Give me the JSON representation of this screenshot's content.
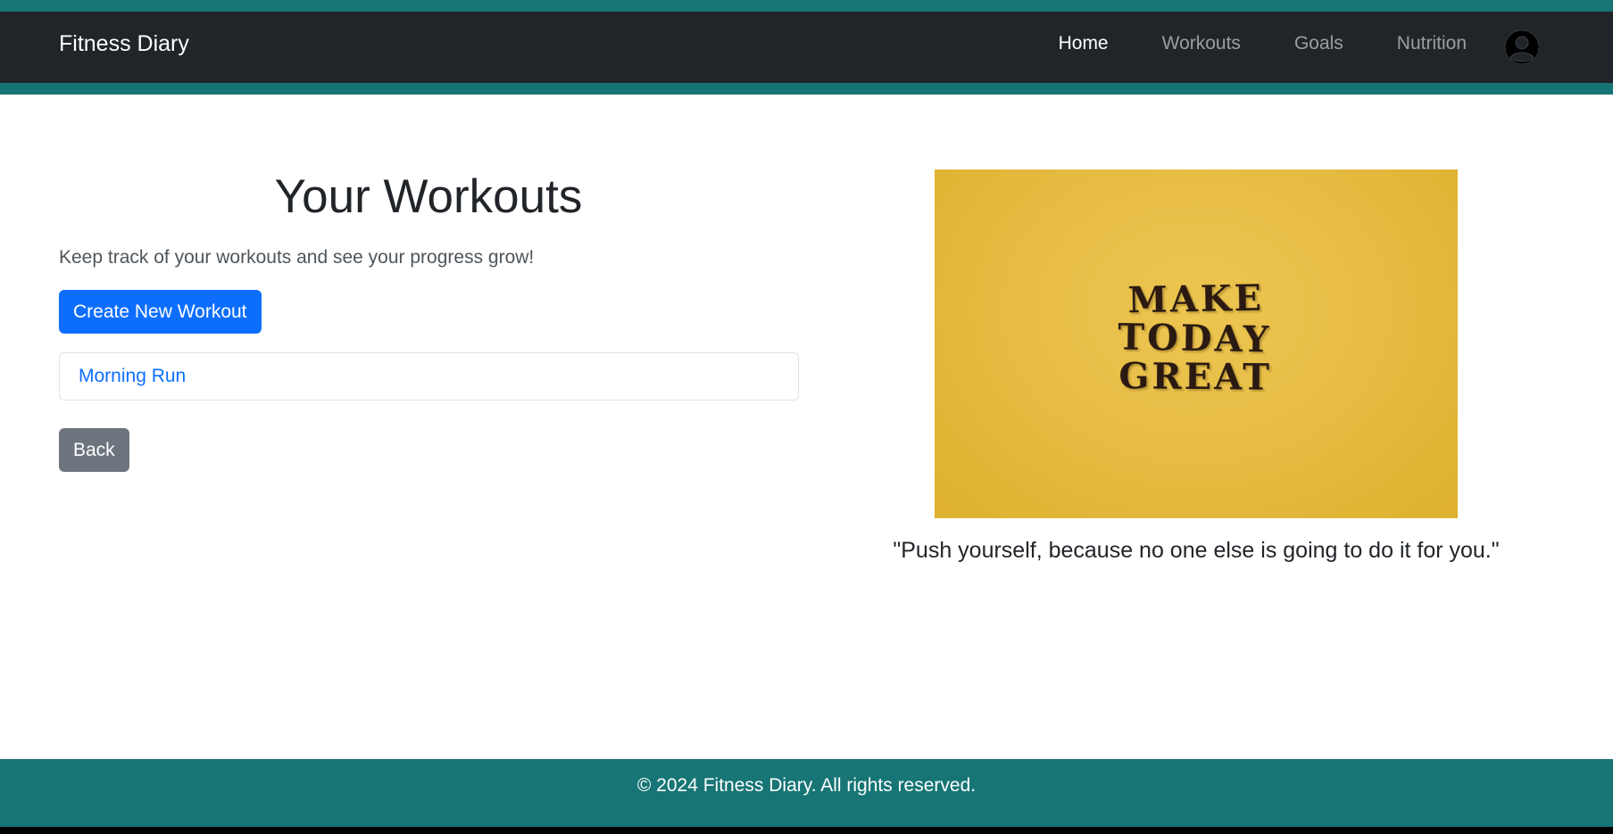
{
  "navbar": {
    "brand": "Fitness Diary",
    "links": [
      {
        "label": "Home",
        "active": true
      },
      {
        "label": "Workouts",
        "active": false
      },
      {
        "label": "Goals",
        "active": false
      },
      {
        "label": "Nutrition",
        "active": false
      }
    ],
    "avatar_icon": "user-circle-icon"
  },
  "main": {
    "title": "Your Workouts",
    "subtitle": "Keep track of your workouts and see your progress grow!",
    "create_button_label": "Create New Workout",
    "workouts": [
      "Morning Run"
    ],
    "back_button_label": "Back"
  },
  "aside": {
    "image_text": [
      "MAKE",
      "TODAY",
      "GREAT"
    ],
    "quote": "\"Push yourself, because no one else is going to do it for you.\""
  },
  "footer": {
    "text": "© 2024 Fitness Diary. All rights reserved."
  },
  "colors": {
    "stripe": "#177575",
    "navbar": "#212529",
    "primary": "#0d6efd",
    "secondary": "#6c757d",
    "image_background": "#e6bc44",
    "image_lettering": "#2a1a12"
  }
}
